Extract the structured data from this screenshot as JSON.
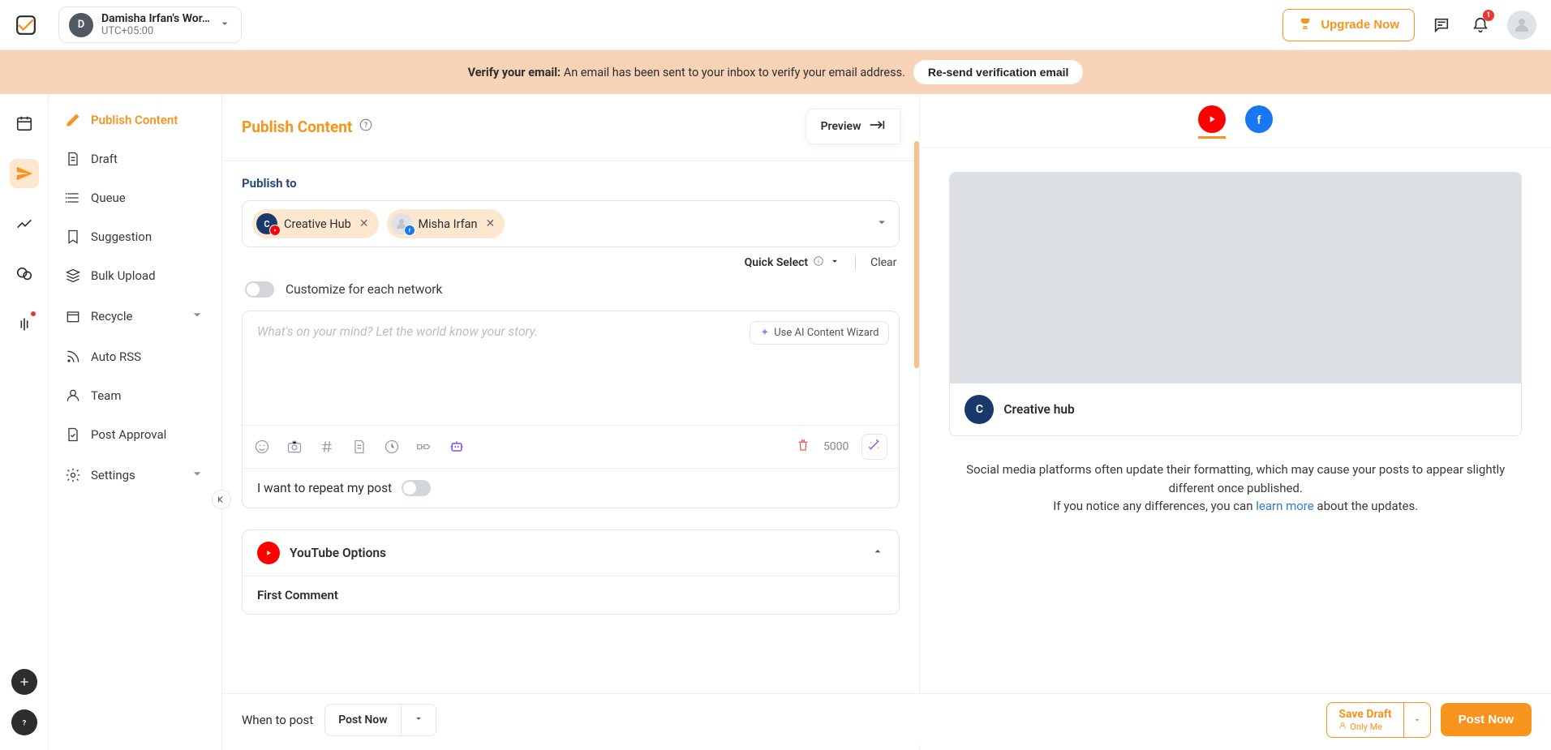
{
  "header": {
    "workspace_name": "Damisha Irfan's Wor…",
    "workspace_tz": "UTC+05:00",
    "workspace_initial": "D",
    "upgrade_label": "Upgrade Now",
    "notif_count": "1"
  },
  "banner": {
    "label": "Verify your email:",
    "message": " An email has been sent to your inbox to verify your email address.",
    "button": "Re-send verification email"
  },
  "sidebar": {
    "items": [
      {
        "label": "Publish Content"
      },
      {
        "label": "Draft"
      },
      {
        "label": "Queue"
      },
      {
        "label": "Suggestion"
      },
      {
        "label": "Bulk Upload"
      },
      {
        "label": "Recycle"
      },
      {
        "label": "Auto RSS"
      },
      {
        "label": "Team"
      },
      {
        "label": "Post Approval"
      },
      {
        "label": "Settings"
      }
    ]
  },
  "compose": {
    "title": "Publish Content",
    "preview_label": "Preview",
    "publish_to_label": "Publish to",
    "accounts": [
      {
        "name": "Creative Hub",
        "initial": "C",
        "network": "youtube"
      },
      {
        "name": "Misha Irfan",
        "initial": "",
        "network": "facebook"
      }
    ],
    "quick_select": "Quick Select",
    "clear": "Clear",
    "customize_label": "Customize for each network",
    "placeholder": "What's on your mind? Let the world know your story.",
    "ai_wizard": "Use AI Content Wizard",
    "char_count": "5000",
    "repeat_label": "I want to repeat my post",
    "yt_options": "YouTube Options",
    "first_comment": "First Comment"
  },
  "bottom": {
    "when_label": "When to post",
    "when_value": "Post Now",
    "save_draft": "Save Draft",
    "only_me": "Only Me",
    "post_now": "Post Now"
  },
  "preview": {
    "account_name": "Creative hub",
    "account_initial": "C",
    "note_1": "Social media platforms often update their formatting, which may cause your posts to appear slightly different once published.",
    "note_2a": "If you notice any differences, you can ",
    "learn_more": "learn more",
    "note_2b": " about the updates."
  }
}
